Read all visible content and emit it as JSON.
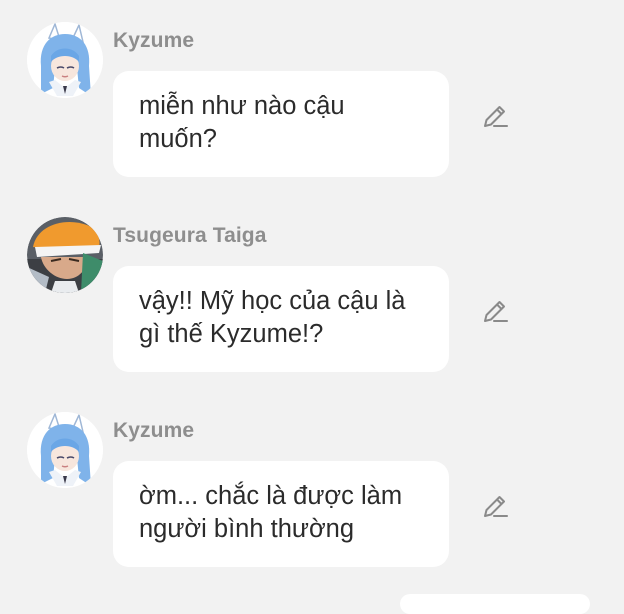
{
  "chat": {
    "messages": [
      {
        "sender": "Kyzume",
        "text": "miễn như nào cậu muốn?",
        "avatar_icon": "blue-hair-character-avatar"
      },
      {
        "sender": "Tsugeura Taiga",
        "text": "vậy!! Mỹ học của cậu là gì thế Kyzume!?",
        "avatar_icon": "orange-hat-character-avatar"
      },
      {
        "sender": "Kyzume",
        "text": "ờm... chắc là được làm người bình thường",
        "avatar_icon": "blue-hair-character-avatar"
      }
    ],
    "edit_icon": "pencil-icon"
  },
  "colors": {
    "background": "#f2f2f2",
    "bubble": "#ffffff",
    "sender_name": "#8e8e8e",
    "message_text": "#2b2b2b",
    "icon": "#8a8a8a"
  }
}
